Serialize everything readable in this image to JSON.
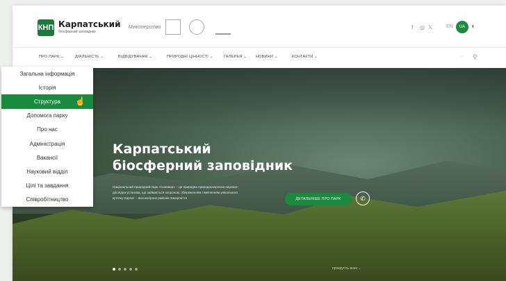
{
  "brand": {
    "logo_glyph": "КНП",
    "name": "Карпатський",
    "subtitle": "біосферний заповідник"
  },
  "partners": [
    "Міністерство",
    "",
    "",
    ""
  ],
  "social": [
    "f",
    "◎",
    "𝕏"
  ],
  "lang": "EN",
  "lang_active": "UA",
  "nav": {
    "items": [
      "ПРО ПАРК ⌄",
      "ДІЯЛЬНІСТЬ ⌄",
      "ВІДВІДУВАЧАМ ⌄",
      "ПРИРОДНІ ЦІННОСТІ ⌄",
      "ГАЛЕРЕЯ ⌄",
      "НОВИНИ ⌄",
      "КОНТАКТИ ⌄"
    ]
  },
  "dropdown": {
    "items": [
      "Загальна інформація",
      "Історія",
      "Структура",
      "Допомога парку",
      "Про нас",
      "Адміністрація",
      "Вакансії",
      "Науковий відділ",
      "Цілі та завдання",
      "Співробітництво"
    ],
    "active_index": 2
  },
  "hero": {
    "title_line1": "Карпатський",
    "title_line2": "біосферний заповідник",
    "description": "Національний природний парк «Синевир» – це природна природоохоронна науково-дослідна установа, що займається охороною, збереженням і вивченням унікального куточку Карпат – високогірних районів Закарпаття",
    "cta": "ДЕТАЛЬНІШЕ ПРО ПАРК",
    "scroll_hint": "прокрутіть вниз ⌄"
  },
  "colors": {
    "accent": "#1a8a3e"
  }
}
